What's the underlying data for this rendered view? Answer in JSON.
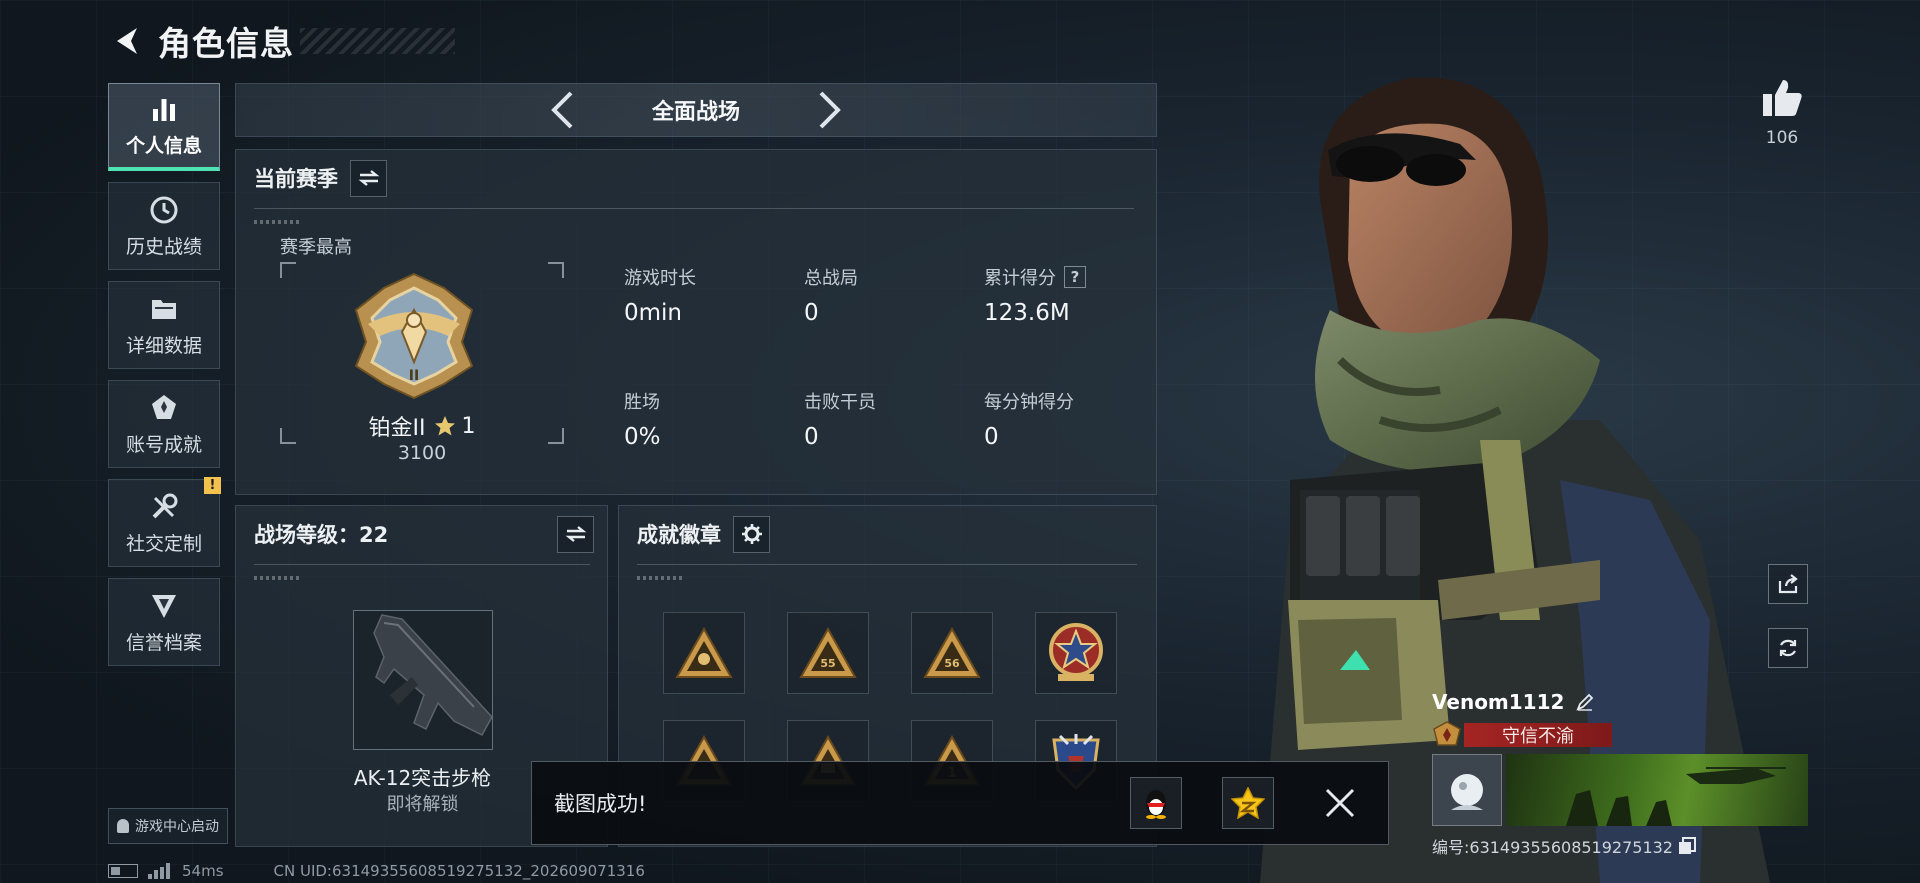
{
  "header": {
    "title": "角色信息"
  },
  "sidebar": {
    "items": [
      {
        "label": "个人信息",
        "icon": "bar-chart-icon",
        "active": true
      },
      {
        "label": "历史战绩",
        "icon": "clock-icon"
      },
      {
        "label": "详细数据",
        "icon": "folder-icon"
      },
      {
        "label": "账号成就",
        "icon": "medal-icon"
      },
      {
        "label": "社交定制",
        "icon": "wrench-icon",
        "badge": "!"
      },
      {
        "label": "信誉档案",
        "icon": "shield-icon"
      }
    ],
    "launch_label": "游戏中心启动"
  },
  "mode": {
    "title": "全面战场"
  },
  "season": {
    "heading": "当前赛季",
    "best_label": "赛季最高",
    "rank_name": "铂金II",
    "rank_stars": "1",
    "rank_score": "3100",
    "rank_numeral": "II",
    "stats": [
      {
        "label": "游戏时长",
        "value": "0min"
      },
      {
        "label": "总战局",
        "value": "0"
      },
      {
        "label": "累计得分",
        "value": "123.6M",
        "help": "?"
      },
      {
        "label": "胜场",
        "value": "0%"
      },
      {
        "label": "击败干员",
        "value": "0"
      },
      {
        "label": "每分钟得分",
        "value": "0"
      }
    ]
  },
  "level": {
    "heading": "战场等级：22",
    "weapon_name": "AK-12突击步枪",
    "weapon_status": "即将解锁"
  },
  "badges": {
    "heading": "成就徽章",
    "medal_labels": [
      "55",
      "56",
      "1"
    ]
  },
  "toast": {
    "message": "截图成功!"
  },
  "social": {
    "likes": "106"
  },
  "player": {
    "name": "Venom1112",
    "title": "守信不渝",
    "id_text": "编号:6314935560851927513​2"
  },
  "statusbar": {
    "ping": "54ms",
    "uid": "CN UID:6314935560851927513​2_202609071316"
  },
  "colors": {
    "accent": "#4fe3b4",
    "ribbon": "#a52523",
    "gold": "#c9a04a",
    "alert": "#f2c14e"
  }
}
